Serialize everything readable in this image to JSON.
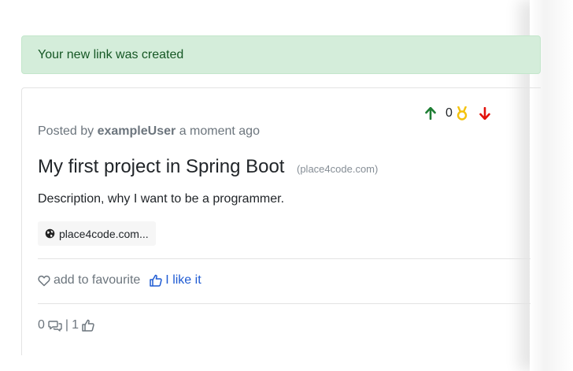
{
  "alert": {
    "message": "Your new link was created"
  },
  "post": {
    "vote_count": "0",
    "posted_prefix": "Posted by",
    "username": "exampleUser",
    "posted_time": "a moment ago",
    "title": "My first project in Spring Boot",
    "domain": "(place4code.com)",
    "description": "Description, why I want to be a programmer.",
    "link_label": "place4code.com..."
  },
  "actions": {
    "favourite_label": "add to favourite",
    "like_label": "I like it"
  },
  "stats": {
    "comments_count": "0",
    "separator": "|",
    "likes_count": "1"
  },
  "colors": {
    "alert_bg": "#d4edda",
    "alert_text": "#155724",
    "up_arrow": "#1e7e34",
    "down_arrow": "#e3120b",
    "medal": "#f4c20d",
    "like_blue": "#1f5bd3"
  },
  "icons": [
    "arrow-up-icon",
    "medal-icon",
    "arrow-down-icon",
    "globe-icon",
    "heart-icon",
    "thumbs-up-icon",
    "comments-icon"
  ]
}
